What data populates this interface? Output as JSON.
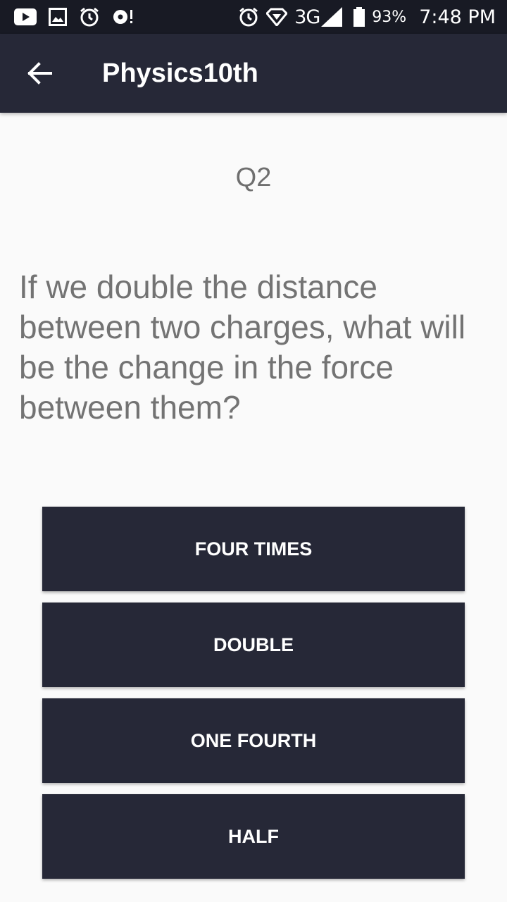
{
  "status_bar": {
    "left_icons": [
      "youtube-icon",
      "image-icon",
      "alarm-icon",
      "sync-alert-icon"
    ],
    "right_icons": [
      "alarm-icon",
      "wifi-icon",
      "signal-icon",
      "battery-icon"
    ],
    "network": "3G",
    "battery": "93%",
    "time": "7:48 PM"
  },
  "toolbar": {
    "back_icon": "arrow-back-icon",
    "title": "Physics10th",
    "background": "#262837"
  },
  "quiz": {
    "question_number": "Q2",
    "question_text": "If we double the distance between two charges, what will be the change in the force between them?",
    "answers": [
      "FOUR TIMES",
      "DOUBLE",
      "ONE FOURTH",
      "HALF"
    ]
  },
  "colors": {
    "status_bar": "#181a24",
    "accent_dark": "#262837",
    "background": "#fafafa",
    "question_text": "#737373"
  }
}
